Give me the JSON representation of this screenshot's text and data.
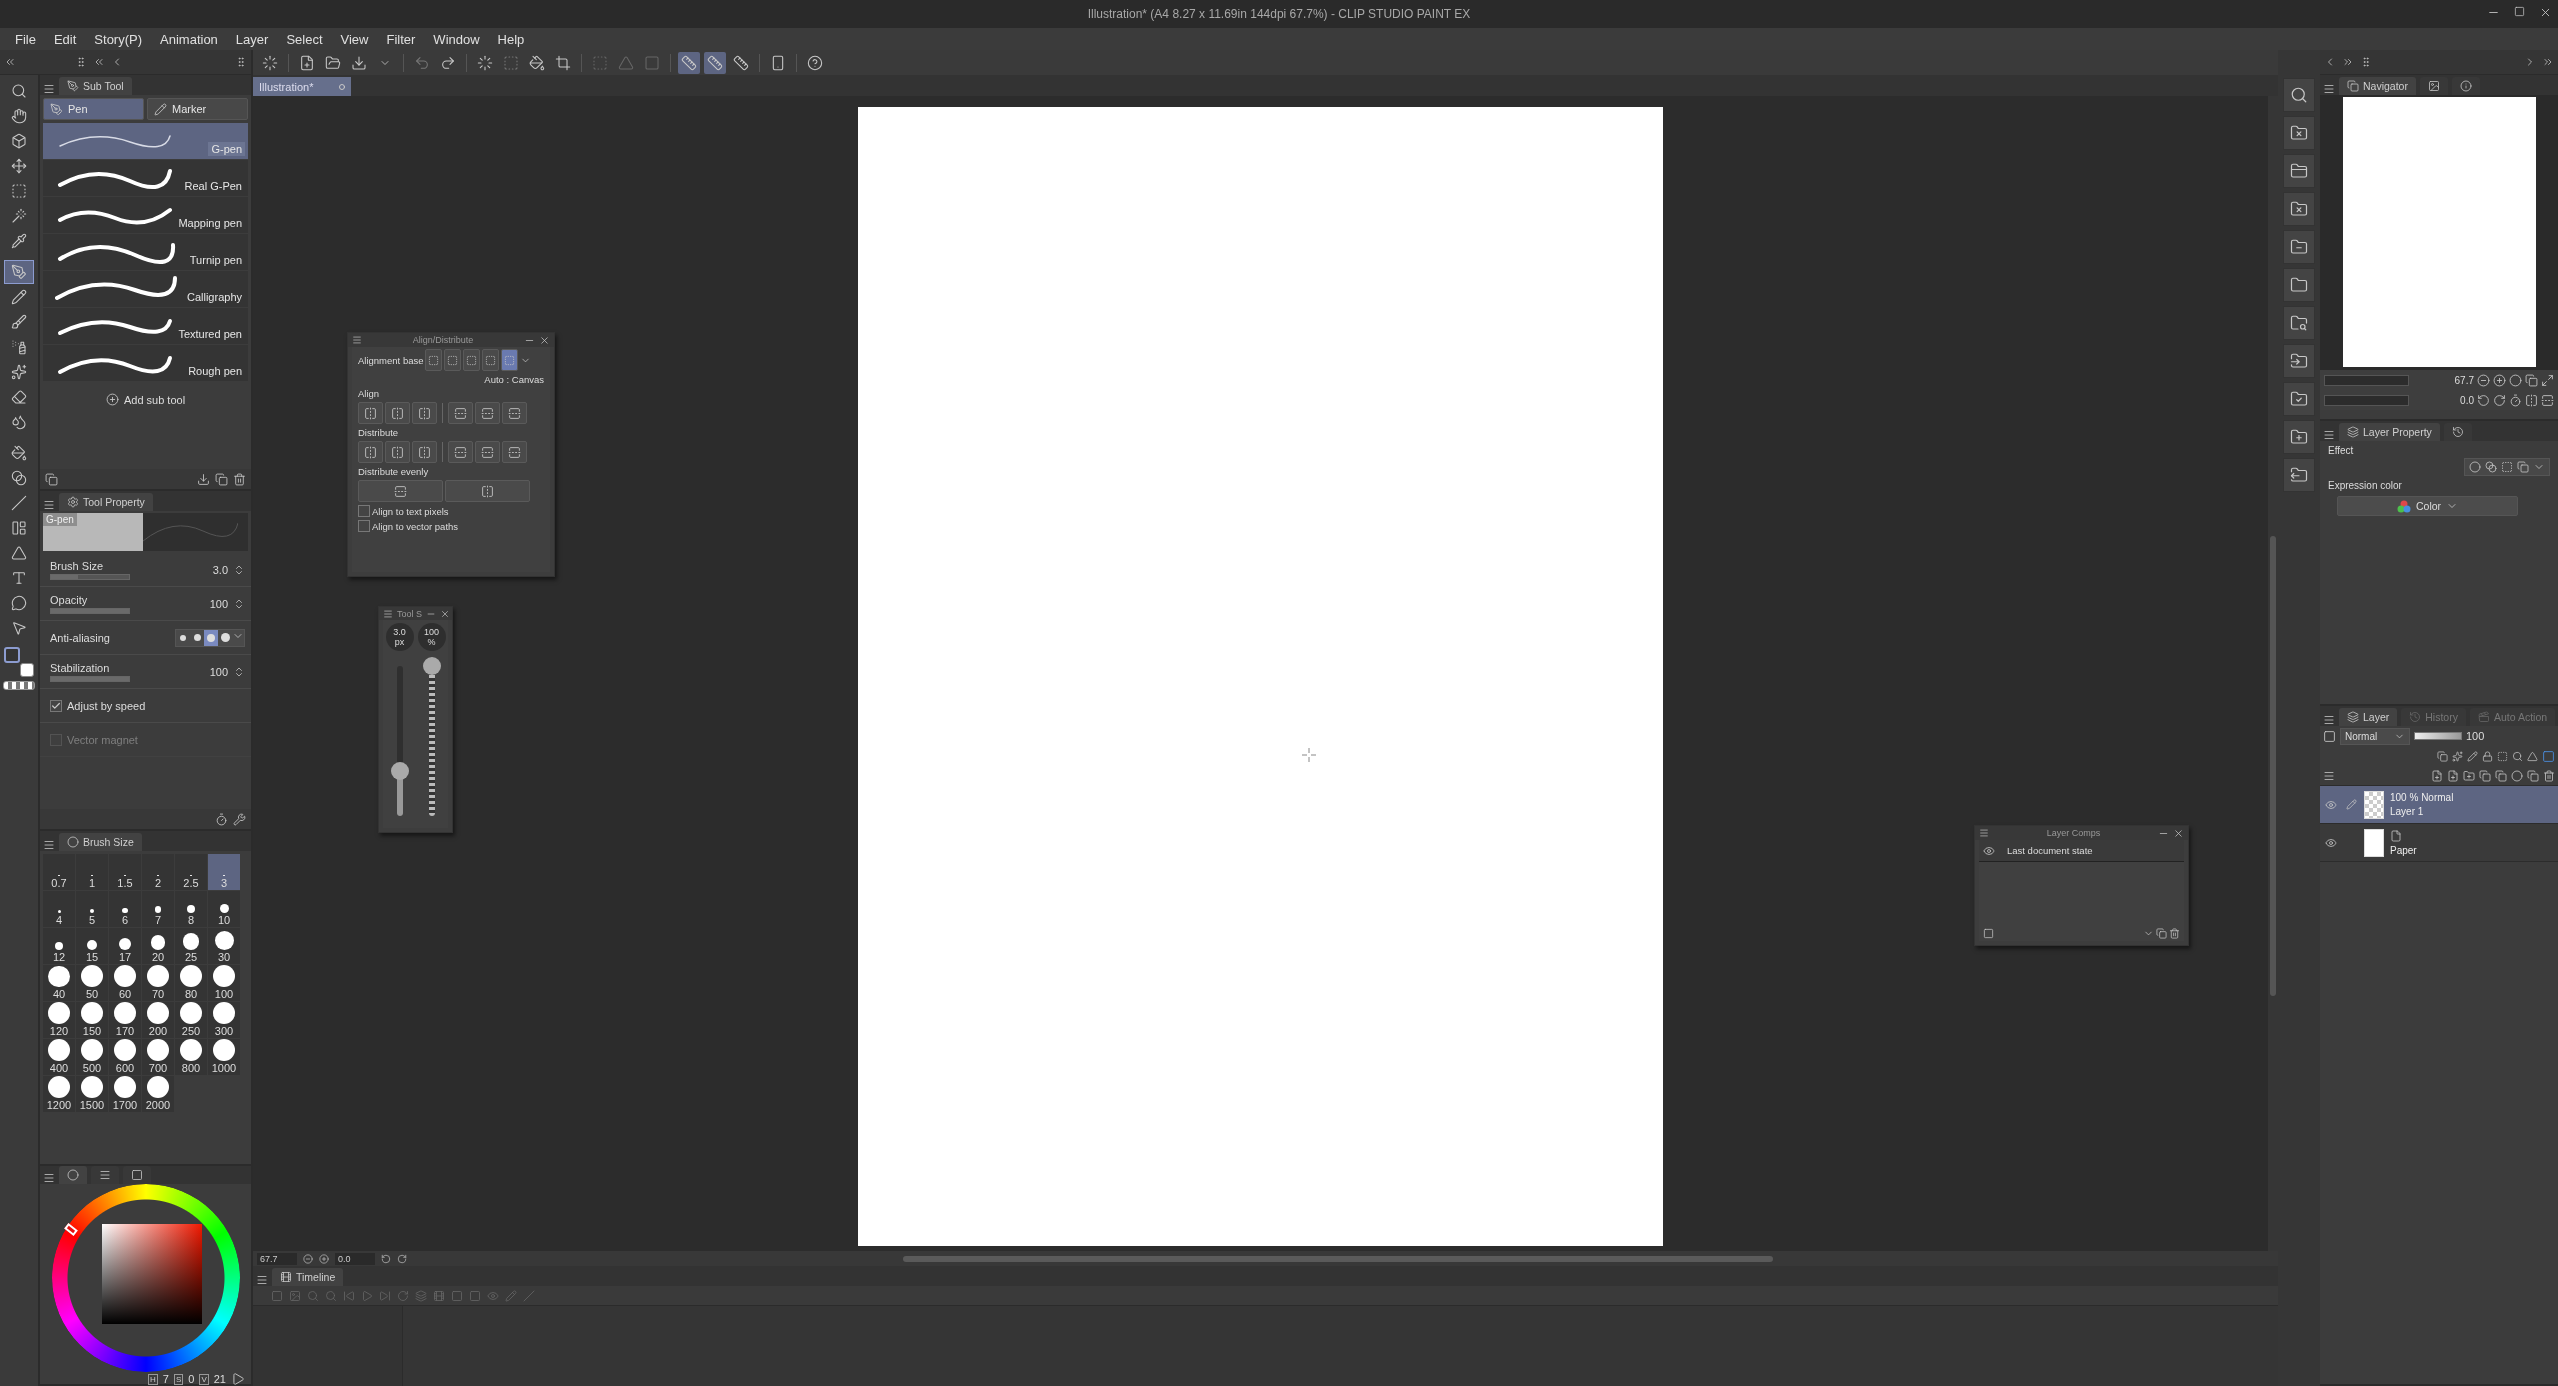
{
  "window": {
    "title": "Illustration* (A4 8.27 x 11.69in 144dpi 67.7%) - CLIP STUDIO PAINT EX"
  },
  "menu": [
    "File",
    "Edit",
    "Story(P)",
    "Animation",
    "Layer",
    "Select",
    "View",
    "Filter",
    "Window",
    "Help"
  ],
  "tools": [
    {
      "selected": false
    },
    {
      "selected": false
    },
    {
      "selected": false
    },
    {
      "selected": false
    },
    {
      "selected": false
    },
    {
      "selected": false
    },
    {
      "selected": false
    },
    {
      "selected": true
    },
    {
      "selected": false
    },
    {
      "selected": false
    },
    {
      "selected": false
    },
    {
      "selected": false
    },
    {
      "selected": false
    },
    {
      "selected": false
    },
    {
      "selected": false
    },
    {
      "selected": false
    },
    {
      "selected": false
    },
    {
      "selected": false
    },
    {
      "selected": false
    },
    {
      "selected": false
    },
    {
      "selected": false
    },
    {
      "selected": false
    }
  ],
  "snap_buttons": [
    {
      "selected": true
    },
    {
      "selected": true
    },
    {
      "selected": false
    }
  ],
  "document_tab": {
    "label": "Illustration*",
    "selected": true
  },
  "sub_tool": {
    "title": "Sub Tool",
    "groups": [
      {
        "label": "Pen",
        "selected": true
      },
      {
        "label": "Marker",
        "selected": false
      }
    ],
    "items": [
      {
        "label": "G-pen",
        "selected": true
      },
      {
        "label": "Real G-Pen",
        "selected": false
      },
      {
        "label": "Mapping pen",
        "selected": false
      },
      {
        "label": "Turnip pen",
        "selected": false
      },
      {
        "label": "Calligraphy",
        "selected": false
      },
      {
        "label": "Textured pen",
        "selected": false
      },
      {
        "label": "Rough pen",
        "selected": false
      }
    ],
    "add_button": "Add sub tool"
  },
  "tool_property": {
    "title": "Tool Property",
    "preview_label": "G-pen",
    "rows": [
      {
        "kind": "slider",
        "label": "Brush Size",
        "value": "3.0",
        "level": 0.35
      },
      {
        "kind": "slider",
        "label": "Opacity",
        "value": "100",
        "level": 1
      },
      {
        "kind": "choice",
        "label": "Anti-aliasing",
        "options": [
          {
            "selected": false
          },
          {
            "selected": false
          },
          {
            "selected": true
          },
          {
            "selected": false
          }
        ]
      },
      {
        "kind": "slider",
        "label": "Stabilization",
        "value": "100",
        "level": 1
      },
      {
        "kind": "check",
        "label": "Adjust by speed",
        "checked": true,
        "disabled": false
      },
      {
        "kind": "check",
        "label": "Vector magnet",
        "checked": false,
        "disabled": true
      }
    ]
  },
  "brush_size": {
    "title": "Brush Size",
    "sizes": [
      {
        "label": "0.7",
        "selected": false
      },
      {
        "label": "1",
        "selected": false
      },
      {
        "label": "1.5",
        "selected": false
      },
      {
        "label": "2",
        "selected": false
      },
      {
        "label": "2.5",
        "selected": false
      },
      {
        "label": "3",
        "selected": true
      },
      {
        "label": "4",
        "selected": false
      },
      {
        "label": "5",
        "selected": false
      },
      {
        "label": "6",
        "selected": false
      },
      {
        "label": "7",
        "selected": false
      },
      {
        "label": "8",
        "selected": false
      },
      {
        "label": "10",
        "selected": false
      },
      {
        "label": "12",
        "selected": false
      },
      {
        "label": "15",
        "selected": false
      },
      {
        "label": "17",
        "selected": false
      },
      {
        "label": "20",
        "selected": false
      },
      {
        "label": "25",
        "selected": false
      },
      {
        "label": "30",
        "selected": false
      },
      {
        "label": "40",
        "selected": false
      },
      {
        "label": "50",
        "selected": false
      },
      {
        "label": "60",
        "selected": false
      },
      {
        "label": "70",
        "selected": false
      },
      {
        "label": "80",
        "selected": false
      },
      {
        "label": "100",
        "selected": false
      },
      {
        "label": "120",
        "selected": false
      },
      {
        "label": "150",
        "selected": false
      },
      {
        "label": "170",
        "selected": false
      },
      {
        "label": "200",
        "selected": false
      },
      {
        "label": "250",
        "selected": false
      },
      {
        "label": "300",
        "selected": false
      },
      {
        "label": "400",
        "selected": false
      },
      {
        "label": "500",
        "selected": false
      },
      {
        "label": "600",
        "selected": false
      },
      {
        "label": "700",
        "selected": false
      },
      {
        "label": "800",
        "selected": false
      },
      {
        "label": "1000",
        "selected": false
      },
      {
        "label": "1200",
        "selected": false
      },
      {
        "label": "1500",
        "selected": false
      },
      {
        "label": "1700",
        "selected": false
      },
      {
        "label": "2000",
        "selected": false
      }
    ]
  },
  "color": {
    "readings": [
      {
        "key": "H",
        "value": "7"
      },
      {
        "key": "S",
        "value": "0"
      },
      {
        "key": "V",
        "value": "21"
      }
    ]
  },
  "align_panel": {
    "title": "Align/Distribute",
    "base_label": "Alignment base",
    "base_options": [
      {
        "selected": false
      },
      {
        "selected": false
      },
      {
        "selected": false
      },
      {
        "selected": false
      },
      {
        "selected": true
      }
    ],
    "base_value": "Auto : Canvas",
    "sections": [
      "Align",
      "Distribute",
      "Distribute evenly"
    ],
    "checks": [
      {
        "label": "Align to text pixels",
        "checked": false
      },
      {
        "label": "Align to vector paths",
        "checked": false
      }
    ]
  },
  "tool_slider_panel": {
    "title": "Tool S",
    "sliders": [
      {
        "value": "3.0",
        "unit": "px",
        "level": 0.3
      },
      {
        "value": "100",
        "unit": "%",
        "level": 1
      }
    ]
  },
  "layer_comps": {
    "title": "Layer Comps",
    "items": [
      "Last document state"
    ]
  },
  "canvas_status": {
    "zoom": "67.7",
    "angle": "0.0"
  },
  "timeline": {
    "title": "Timeline"
  },
  "navigator": {
    "title": "Navigator",
    "zoom": "67.7",
    "rotation": "0.0"
  },
  "layer_property": {
    "title": "Layer Property",
    "effect_label": "Effect",
    "expression_label": "Expression color",
    "expression_value": "Color"
  },
  "layer_panel": {
    "tabs": [
      {
        "label": "Layer",
        "selected": true
      },
      {
        "label": "History",
        "selected": false
      },
      {
        "label": "Auto Action",
        "selected": false
      }
    ],
    "blend_mode": "Normal",
    "opacity": "100",
    "opacity_bar": {
      "level": 1
    },
    "layers": [
      {
        "kind": "raster",
        "info": "100 % Normal",
        "name": "Layer 1",
        "selected": true,
        "visible": true
      },
      {
        "kind": "paper",
        "name": "Paper",
        "selected": false,
        "visible": true
      }
    ]
  }
}
